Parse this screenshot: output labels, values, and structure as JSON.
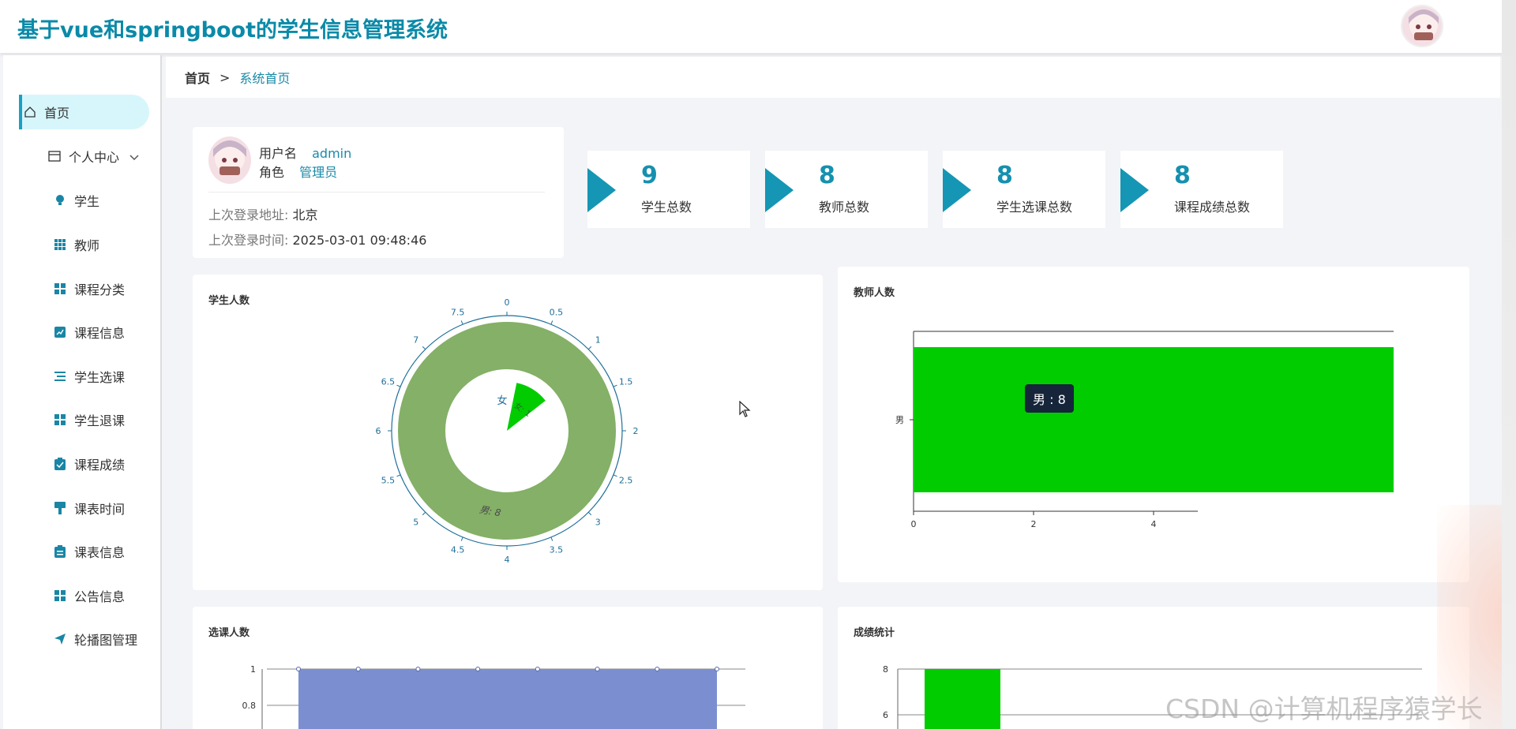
{
  "header": {
    "title": "基于vue和springboot的学生信息管理系统"
  },
  "sidebar": {
    "items": [
      {
        "label": "首页",
        "icon": "home-icon"
      },
      {
        "label": "个人中心",
        "icon": "card-icon"
      },
      {
        "label": "学生",
        "icon": "bulb-icon"
      },
      {
        "label": "教师",
        "icon": "grid-icon"
      },
      {
        "label": "课程分类",
        "icon": "apps-icon"
      },
      {
        "label": "课程信息",
        "icon": "chart-icon"
      },
      {
        "label": "学生选课",
        "icon": "list-icon"
      },
      {
        "label": "学生退课",
        "icon": "apps-icon"
      },
      {
        "label": "课程成绩",
        "icon": "clipboard-check-icon"
      },
      {
        "label": "课表时间",
        "icon": "brush-icon"
      },
      {
        "label": "课表信息",
        "icon": "clipboard-icon"
      },
      {
        "label": "公告信息",
        "icon": "apps-icon"
      },
      {
        "label": "轮播图管理",
        "icon": "send-icon"
      }
    ]
  },
  "breadcrumb": {
    "home": "首页",
    "separator": ">",
    "current": "系统首页"
  },
  "user": {
    "username_label": "用户名",
    "username": "admin",
    "role_label": "角色",
    "role": "管理员",
    "last_addr_label": "上次登录地址:",
    "last_addr": "北京",
    "last_time_label": "上次登录时间:",
    "last_time": "2025-03-01 09:48:46"
  },
  "stats": [
    {
      "value": "9",
      "label": "学生总数"
    },
    {
      "value": "8",
      "label": "教师总数"
    },
    {
      "value": "8",
      "label": "学生选课总数"
    },
    {
      "value": "8",
      "label": "课程成绩总数"
    }
  ],
  "colors": {
    "accent": "#1596b4",
    "green": "#00cc00",
    "olive": "#84b067",
    "blue": "#7b8fd0"
  },
  "chart_data": [
    {
      "type": "pie",
      "title": "学生人数",
      "angle_ticks": [
        "0",
        "0.5",
        "1",
        "1.5",
        "2",
        "2.5",
        "3",
        "3.5",
        "4",
        "4.5",
        "5",
        "5.5",
        "6",
        "6.5",
        "7",
        "7.5"
      ],
      "series": [
        {
          "name": "男",
          "values": [
            8
          ],
          "label": "男: 8"
        },
        {
          "name": "女",
          "values": [
            1
          ],
          "label": "女: 1"
        }
      ],
      "radius_label": "女"
    },
    {
      "type": "bar",
      "title": "教师人数",
      "categories": [
        "男"
      ],
      "values": [
        8
      ],
      "x_ticks": [
        "0",
        "2",
        "4"
      ],
      "tooltip": "男 : 8"
    },
    {
      "type": "area",
      "title": "选课人数",
      "y_ticks": [
        "1",
        "0.8"
      ],
      "values": [
        1,
        1,
        1,
        1,
        1,
        1,
        1,
        1
      ]
    },
    {
      "type": "bar",
      "title": "成绩统计",
      "y_ticks": [
        "8",
        "6"
      ],
      "values": [
        8
      ]
    }
  ],
  "watermark": "CSDN @计算机程序猿学长"
}
